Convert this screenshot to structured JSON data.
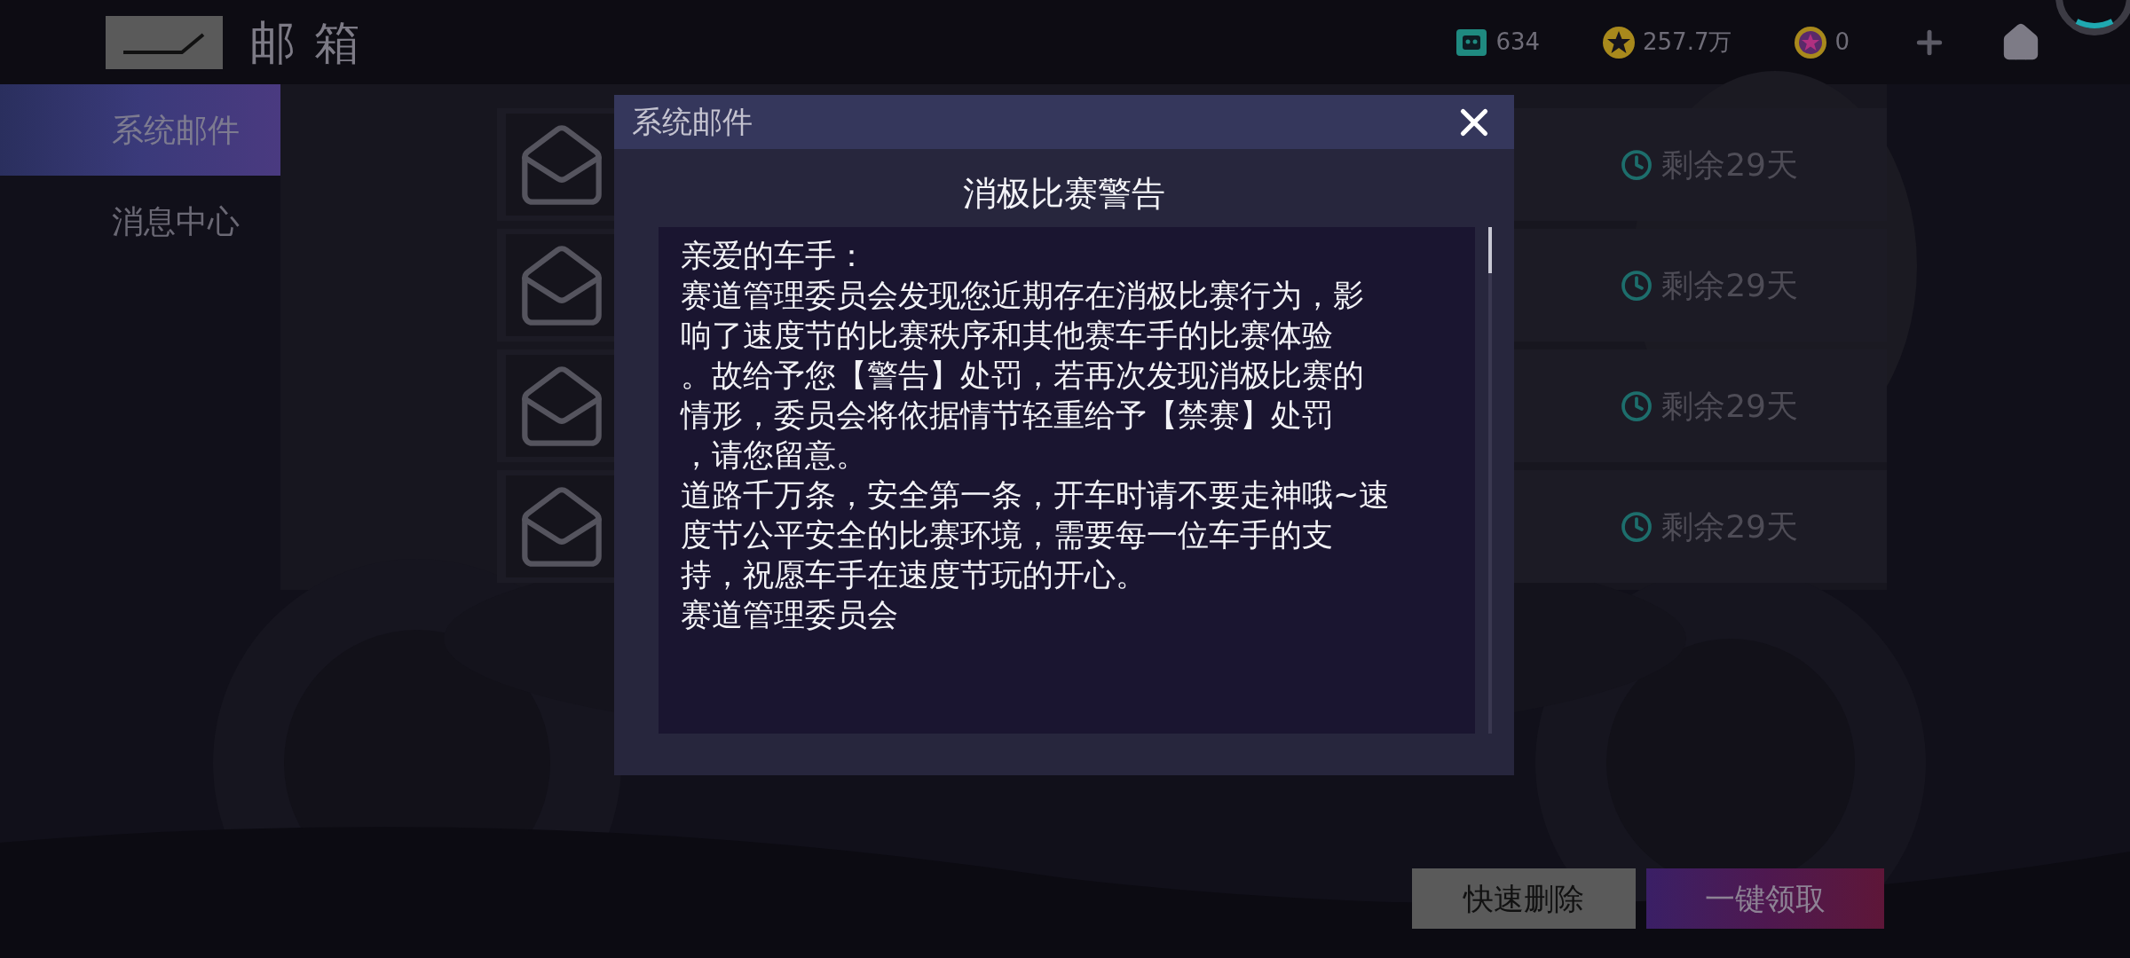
{
  "header": {
    "title": "邮箱"
  },
  "currencies": [
    {
      "kind": "ticket",
      "amount": "634"
    },
    {
      "kind": "coin",
      "amount": "257.7万"
    },
    {
      "kind": "gem",
      "amount": "0"
    }
  ],
  "sidebar": {
    "items": [
      {
        "label": "系统邮件",
        "selected": true
      },
      {
        "label": "消息中心",
        "selected": false
      }
    ]
  },
  "mail_list": [
    {
      "remaining": "剩余29天"
    },
    {
      "remaining": "剩余29天"
    },
    {
      "remaining": "剩余29天"
    },
    {
      "remaining": "剩余29天"
    }
  ],
  "dialog": {
    "header": "系统邮件",
    "title": "消极比赛警告",
    "body_lines": [
      "亲爱的车手：",
      "赛道管理委员会发现您近期存在消极比赛行为，影",
      "响了速度节的比赛秩序和其他赛车手的比赛体验",
      "。故给予您【警告】处罚，若再次发现消极比赛的",
      "情形，委员会将依据情节轻重给予【禁赛】处罚",
      "，请您留意。",
      "道路千万条，安全第一条，开车时请不要走神哦~速",
      "度节公平安全的比赛环境，需要每一位车手的支",
      "持，祝愿车手在速度节玩的开心。",
      "赛道管理委员会"
    ]
  },
  "buttons": [
    {
      "kind": "delete",
      "label": "快速删除"
    },
    {
      "kind": "claim",
      "label": "一键领取"
    }
  ]
}
